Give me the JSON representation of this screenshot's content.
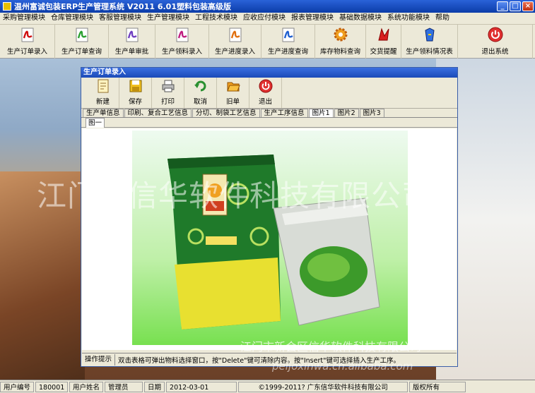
{
  "window": {
    "title": "温州富诚包装ERP生产管理系统   V2011   6.01塑料包装高级版"
  },
  "menu": [
    "采购管理模块",
    "仓库管理模块",
    "客服管理模块",
    "生产管理模块",
    "工程技术模块",
    "应收应付模块",
    "报表管理模块",
    "基础数据模块",
    "系统功能模块",
    "帮助"
  ],
  "toolbar": [
    {
      "label": "生产订单录入",
      "icon": "pdf-icon"
    },
    {
      "label": "生产订单查询",
      "icon": "pdf-icon"
    },
    {
      "label": "生产单审批",
      "icon": "pdf-icon"
    },
    {
      "label": "生产领料录入",
      "icon": "pdf-icon"
    },
    {
      "label": "生产进度录入",
      "icon": "pdf-icon"
    },
    {
      "label": "生产进度查询",
      "icon": "pdf-icon"
    },
    {
      "label": "库存物料查询",
      "icon": "gear-icon"
    },
    {
      "label": "交货提醒",
      "icon": "bell-icon"
    },
    {
      "label": "生产领料情况表",
      "icon": "bell-icon"
    },
    {
      "label": "退出系统",
      "icon": "power-icon"
    }
  ],
  "child": {
    "title": "生产订单录入",
    "buttons": [
      {
        "label": "新建",
        "icon": "new-document-icon"
      },
      {
        "label": "保存",
        "icon": "floppy-disk-icon"
      },
      {
        "label": "打印",
        "icon": "printer-icon"
      },
      {
        "label": "取消",
        "icon": "undo-icon"
      },
      {
        "label": "旧单",
        "icon": "open-folder-icon"
      },
      {
        "label": "退出",
        "icon": "power-icon"
      }
    ],
    "tabs": [
      "生产单信息",
      "印刷、复合工艺信息",
      "分切、制袋工艺信息",
      "生产工序信息",
      "图片1",
      "图片2",
      "图片3"
    ],
    "active_tab": "图片1",
    "subtab": "图一",
    "status": {
      "label": "操作提示",
      "text": "双击表格可弹出物料选择窗口，按\"Delete\"键可清除内容。按\"Insert\"键可选择插入生产工序。"
    }
  },
  "watermarks": {
    "big": "江门市信华软件科技有限公司",
    "small": "江门市新会区信华软件科技有限公司",
    "url": "peijoxinwa.cn.alibaba.com"
  },
  "statusbar": [
    {
      "label": "用户编号",
      "value": "180001"
    },
    {
      "label": "用户姓名",
      "value": "管理员"
    },
    {
      "label": "日期",
      "value": "2012-03-01"
    },
    {
      "label": "copyright",
      "value": "©1999-2011?  广东信华软件科技有限公司"
    },
    {
      "label": "rights",
      "value": "版权所有"
    }
  ],
  "colors": {
    "title_bar": "#0b3ca8",
    "panel": "#ece9d8",
    "photo_green": "#78e050",
    "bag_green": "#1f7a2a",
    "bag_yellow": "#e8e030"
  }
}
